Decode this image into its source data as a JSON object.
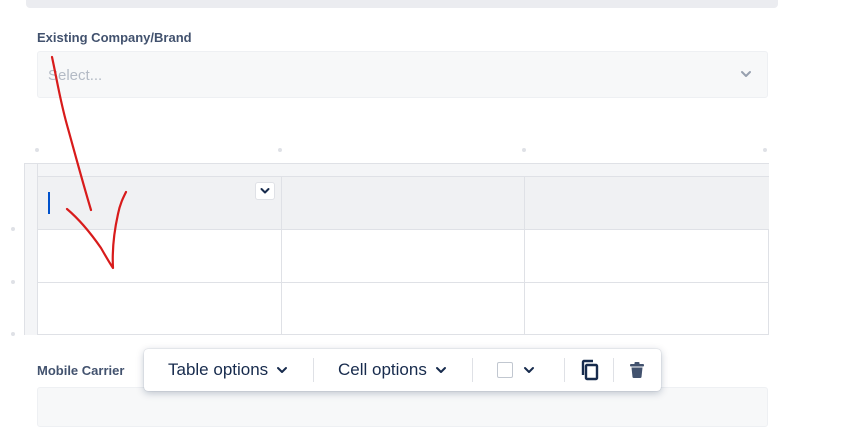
{
  "company_field": {
    "label": "Existing Company/Brand",
    "placeholder": "Select..."
  },
  "carrier_field": {
    "label": "Mobile Carrier"
  },
  "toolbar": {
    "table_options_label": "Table options",
    "cell_options_label": "Cell options",
    "background_color": "#ffffff"
  },
  "icons": {
    "dropdown": "chevron-down-icon",
    "copy": "copy-icon",
    "delete": "trash-icon"
  },
  "annotation": {
    "color": "#d81b1b"
  }
}
